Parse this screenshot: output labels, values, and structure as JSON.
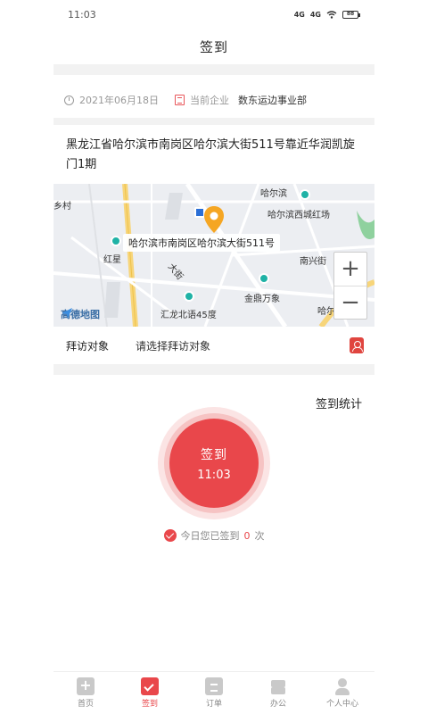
{
  "status_bar": {
    "time": "11:03",
    "signal1": "4G",
    "signal2": "4G",
    "battery": "88"
  },
  "header": {
    "title": "签到"
  },
  "info": {
    "date": "2021年06月18日",
    "company_label": "当前企业",
    "company_name": "数东运边事业部"
  },
  "address": {
    "text": "黑龙江省哈尔滨市南岗区哈尔滨大街511号靠近华润凯旋门1期"
  },
  "map": {
    "callout": "哈尔滨市南岗区哈尔滨大街511号",
    "labels": {
      "village": "乡村",
      "top_right": "哈尔滨",
      "mall": "哈尔滨西城红场",
      "poi_left": "红星",
      "street": "大街",
      "south": "南兴街",
      "jinding": "金鼎万象",
      "road": "汇龙北语45度",
      "harbin_ave": "哈尔滨大街"
    },
    "zoom_in": "+",
    "zoom_out": "−",
    "provider": "高德地图",
    "accent": "#f5a623",
    "poi_color": "#1fb2a6"
  },
  "visit": {
    "label": "拜访对象",
    "placeholder": "请选择拜访对象"
  },
  "stats": {
    "link": "签到统计"
  },
  "checkin": {
    "label": "签到",
    "time": "11:03"
  },
  "today": {
    "prefix": "今日您已签到",
    "count": "0",
    "suffix": "次"
  },
  "tabs": [
    {
      "label": "首页",
      "icon": "home-icon"
    },
    {
      "label": "签到",
      "icon": "checkin-calendar-icon"
    },
    {
      "label": "订单",
      "icon": "order-icon"
    },
    {
      "label": "办公",
      "icon": "layers-icon"
    },
    {
      "label": "个人中心",
      "icon": "user-icon"
    }
  ],
  "colors": {
    "primary": "#e9474b",
    "divider": "#f2f2f2"
  }
}
